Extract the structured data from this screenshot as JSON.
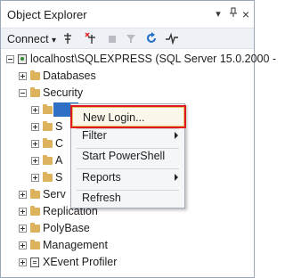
{
  "window": {
    "title": "Object Explorer",
    "buttons": [
      {
        "name": "dropdown-icon",
        "glyph": "▾"
      },
      {
        "name": "pin-icon",
        "glyph": "⊥"
      },
      {
        "name": "close-icon",
        "glyph": "×"
      }
    ]
  },
  "toolbar": {
    "connect_label": "Connect",
    "connect_arrow": "▾",
    "icons": [
      "connect-plug-icon",
      "disconnect-icon",
      "stop-icon",
      "filter-icon",
      "refresh-icon",
      "activity-monitor-icon"
    ]
  },
  "tree": {
    "server": "localhost\\SQLEXPRESS (SQL Server 15.0.2000 -",
    "nodes": {
      "databases": "Databases",
      "security": "Security",
      "server_objects": "Serv",
      "replication": "Replication",
      "polybase": "PolyBase",
      "management": "Management",
      "xevent": "XEvent Profiler",
      "sec_c": "C",
      "sec_a": "A",
      "sec_s": "S",
      "sec_s2": "S"
    }
  },
  "context_menu": {
    "items": [
      {
        "label": "New Login...",
        "submenu": false,
        "highlighted": true
      },
      {
        "label": "Filter",
        "submenu": true
      },
      {
        "label": "Start PowerShell",
        "submenu": false
      },
      {
        "label": "Reports",
        "submenu": true
      },
      {
        "label": "Refresh",
        "submenu": false
      }
    ]
  },
  "colors": {
    "highlight_border": "#e0191f",
    "selection": "#2f6fc4",
    "folder": "#dcb35c"
  }
}
